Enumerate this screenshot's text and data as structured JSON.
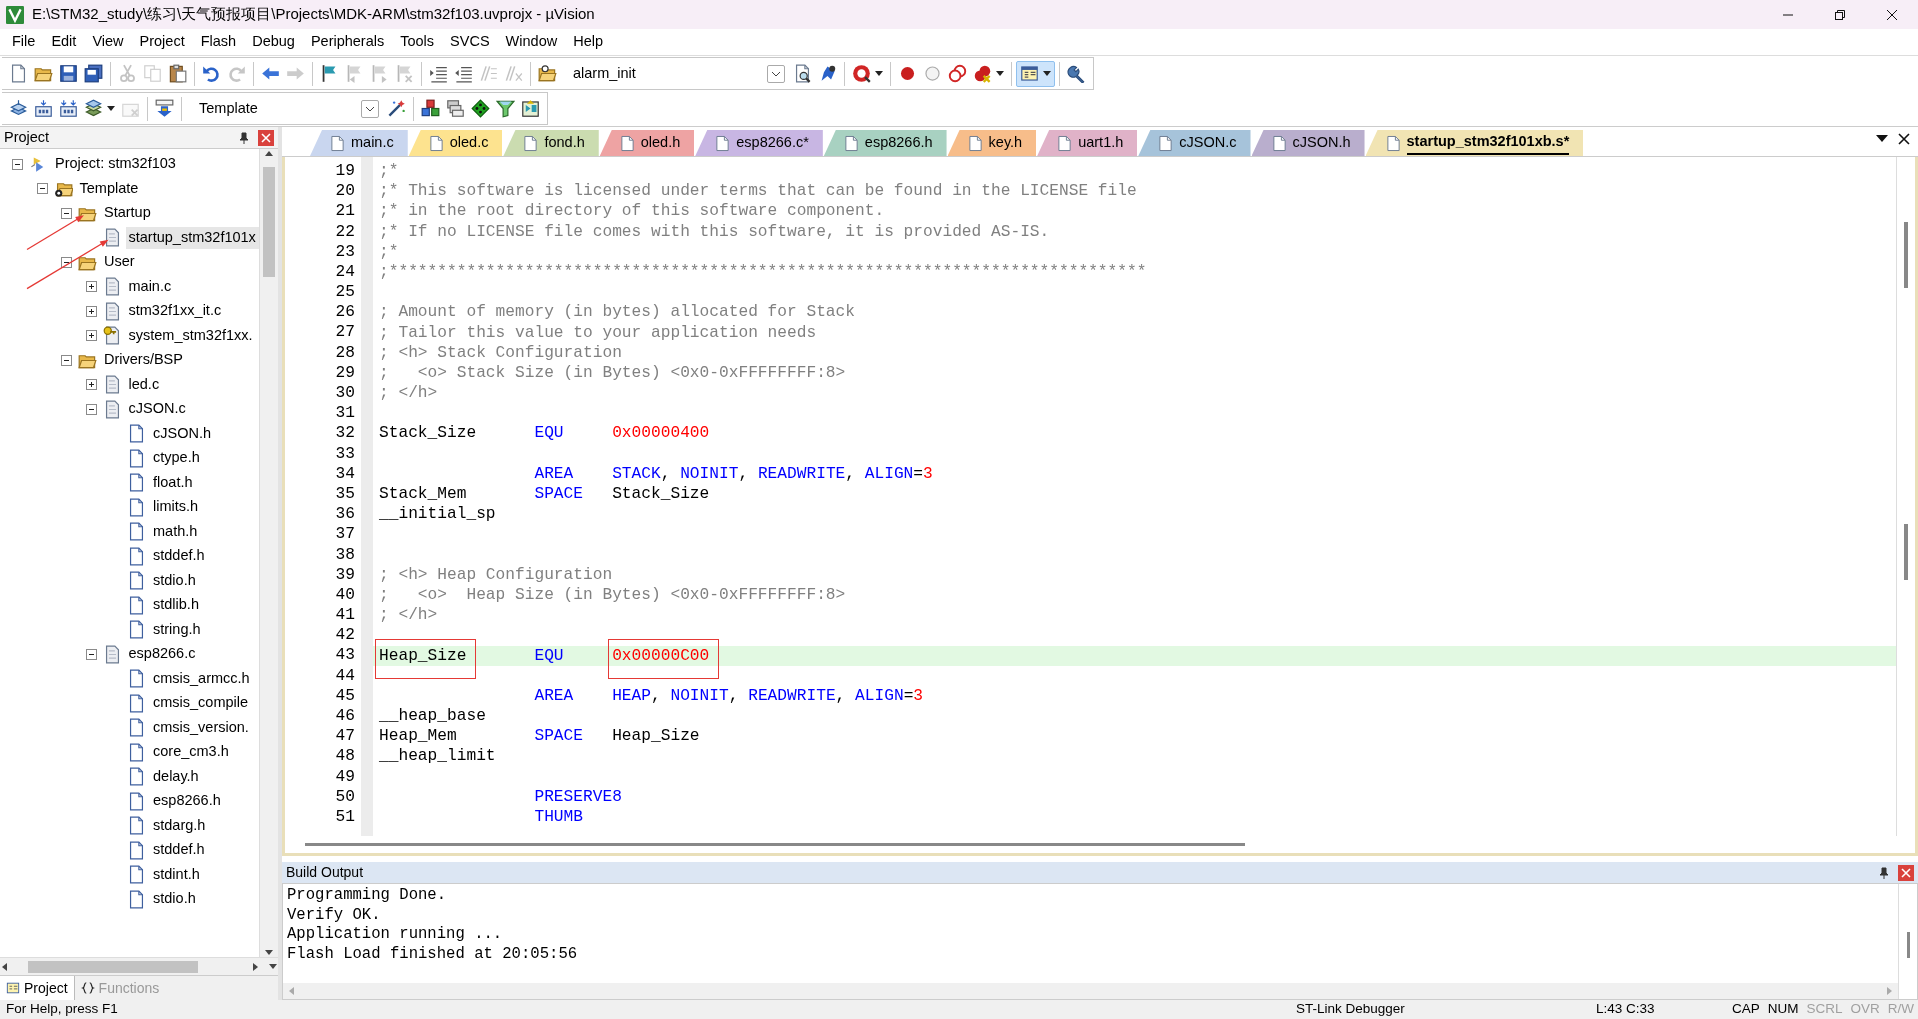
{
  "window": {
    "title": "E:\\STM32_study\\练习\\天气预报项目\\Projects\\MDK-ARM\\stm32f103.uvprojx - µVision"
  },
  "menu": [
    "File",
    "Edit",
    "View",
    "Project",
    "Flash",
    "Debug",
    "Peripherals",
    "Tools",
    "SVCS",
    "Window",
    "Help"
  ],
  "toolbar_1": [
    {
      "kind": "new",
      "disabled": false
    },
    {
      "kind": "open",
      "disabled": false
    },
    {
      "kind": "save",
      "disabled": false
    },
    {
      "kind": "save-all",
      "disabled": false
    },
    {
      "kind": "separator"
    },
    {
      "kind": "cut",
      "disabled": true
    },
    {
      "kind": "copy",
      "disabled": true
    },
    {
      "kind": "paste",
      "disabled": false
    },
    {
      "kind": "separator"
    },
    {
      "kind": "undo",
      "disabled": false
    },
    {
      "kind": "redo",
      "disabled": true
    },
    {
      "kind": "separator"
    },
    {
      "kind": "back",
      "disabled": false
    },
    {
      "kind": "forward",
      "disabled": true
    },
    {
      "kind": "separator"
    },
    {
      "kind": "bookmark",
      "disabled": false
    },
    {
      "kind": "prev-bookmark",
      "disabled": true
    },
    {
      "kind": "next-bookmark",
      "disabled": true
    },
    {
      "kind": "clear-bookmarks",
      "disabled": true
    },
    {
      "kind": "separator"
    },
    {
      "kind": "indent",
      "disabled": false
    },
    {
      "kind": "unindent",
      "disabled": false
    },
    {
      "kind": "comment",
      "disabled": true
    },
    {
      "kind": "uncomment",
      "disabled": true
    },
    {
      "kind": "separator"
    },
    {
      "kind": "find-in-files",
      "disabled": false
    },
    {
      "kind": "combo",
      "value": "alarm_init"
    },
    {
      "kind": "find",
      "disabled": false
    },
    {
      "kind": "incremental-find",
      "disabled": false
    },
    {
      "kind": "separator"
    },
    {
      "kind": "debug",
      "disabled": false,
      "dropdown": true
    },
    {
      "kind": "separator"
    },
    {
      "kind": "breakpoint",
      "disabled": false
    },
    {
      "kind": "breakpoint-off",
      "disabled": false
    },
    {
      "kind": "disable-all",
      "disabled": false
    },
    {
      "kind": "kill-all",
      "disabled": false,
      "dropdown": true
    },
    {
      "kind": "separator"
    },
    {
      "kind": "layout",
      "disabled": false,
      "dropdown": true,
      "on": true
    },
    {
      "kind": "separator"
    },
    {
      "kind": "configure",
      "disabled": false
    }
  ],
  "toolbar_2": [
    {
      "kind": "translate",
      "disabled": false
    },
    {
      "kind": "build",
      "disabled": false
    },
    {
      "kind": "rebuild",
      "disabled": false
    },
    {
      "kind": "batch-build",
      "disabled": false,
      "dropdown": true
    },
    {
      "kind": "stop-build",
      "disabled": true
    },
    {
      "kind": "separator"
    },
    {
      "kind": "download",
      "disabled": false
    },
    {
      "kind": "separator"
    },
    {
      "kind": "combo",
      "value": "Template"
    },
    {
      "kind": "target-options",
      "disabled": false
    },
    {
      "kind": "separator"
    },
    {
      "kind": "manage-items",
      "disabled": false
    },
    {
      "kind": "select-packs",
      "disabled": false
    },
    {
      "kind": "manage-environment",
      "disabled": false
    },
    {
      "kind": "pack-installer",
      "disabled": false
    },
    {
      "kind": "runtime-environment",
      "disabled": false
    }
  ],
  "project_panel": {
    "title": "Project",
    "tree": [
      {
        "label": "Project: stm32f103",
        "kind": "project",
        "expanded": true,
        "selected": false,
        "arrow": false,
        "children": [
          {
            "label": "Template",
            "kind": "target",
            "expanded": true,
            "selected": false,
            "arrow": false,
            "children": [
              {
                "label": "Startup",
                "kind": "folder",
                "expanded": true,
                "selected": false,
                "arrow": true,
                "children": [
                  {
                    "label": "startup_stm32f101x",
                    "kind": "file",
                    "selected": true,
                    "arrow": true
                  }
                ]
              },
              {
                "label": "User",
                "kind": "folder",
                "expanded": true,
                "selected": false,
                "arrow": false,
                "children": [
                  {
                    "label": "main.c",
                    "kind": "file",
                    "expanded": false,
                    "selected": false,
                    "arrow": false
                  },
                  {
                    "label": "stm32f1xx_it.c",
                    "kind": "file",
                    "expanded": false,
                    "selected": false,
                    "arrow": false
                  },
                  {
                    "label": "system_stm32f1xx.",
                    "kind": "config",
                    "expanded": false,
                    "selected": false,
                    "arrow": false
                  }
                ]
              },
              {
                "label": "Drivers/BSP",
                "kind": "folder",
                "expanded": true,
                "selected": false,
                "arrow": false,
                "children": [
                  {
                    "label": "led.c",
                    "kind": "file",
                    "expanded": false,
                    "selected": false,
                    "arrow": false
                  },
                  {
                    "label": "cJSON.c",
                    "kind": "file",
                    "expanded": true,
                    "selected": false,
                    "arrow": false,
                    "children": [
                      {
                        "label": "cJSON.h",
                        "kind": "header",
                        "selected": false,
                        "arrow": false
                      },
                      {
                        "label": "ctype.h",
                        "kind": "header",
                        "selected": false,
                        "arrow": false
                      },
                      {
                        "label": "float.h",
                        "kind": "header",
                        "selected": false,
                        "arrow": false
                      },
                      {
                        "label": "limits.h",
                        "kind": "header",
                        "selected": false,
                        "arrow": false
                      },
                      {
                        "label": "math.h",
                        "kind": "header",
                        "selected": false,
                        "arrow": false
                      },
                      {
                        "label": "stddef.h",
                        "kind": "header",
                        "selected": false,
                        "arrow": false
                      },
                      {
                        "label": "stdio.h",
                        "kind": "header",
                        "selected": false,
                        "arrow": false
                      },
                      {
                        "label": "stdlib.h",
                        "kind": "header",
                        "selected": false,
                        "arrow": false
                      },
                      {
                        "label": "string.h",
                        "kind": "header",
                        "selected": false,
                        "arrow": false
                      }
                    ]
                  },
                  {
                    "label": "esp8266.c",
                    "kind": "file",
                    "expanded": true,
                    "selected": false,
                    "arrow": false,
                    "children": [
                      {
                        "label": "cmsis_armcc.h",
                        "kind": "header",
                        "selected": false,
                        "arrow": false
                      },
                      {
                        "label": "cmsis_compile",
                        "kind": "header",
                        "selected": false,
                        "arrow": false
                      },
                      {
                        "label": "cmsis_version.",
                        "kind": "header",
                        "selected": false,
                        "arrow": false
                      },
                      {
                        "label": "core_cm3.h",
                        "kind": "header",
                        "selected": false,
                        "arrow": false
                      },
                      {
                        "label": "delay.h",
                        "kind": "header",
                        "selected": false,
                        "arrow": false
                      },
                      {
                        "label": "esp8266.h",
                        "kind": "header",
                        "selected": false,
                        "arrow": false
                      },
                      {
                        "label": "stdarg.h",
                        "kind": "header",
                        "selected": false,
                        "arrow": false
                      },
                      {
                        "label": "stddef.h",
                        "kind": "header",
                        "selected": false,
                        "arrow": false
                      },
                      {
                        "label": "stdint.h",
                        "kind": "header",
                        "selected": false,
                        "arrow": false
                      },
                      {
                        "label": "stdio.h",
                        "kind": "header",
                        "selected": false,
                        "arrow": false
                      }
                    ]
                  }
                ]
              }
            ]
          }
        ]
      }
    ],
    "tabs": [
      {
        "label": "Project",
        "kind": "project",
        "selected": true
      },
      {
        "label": "Functions",
        "kind": "functions",
        "selected": false
      }
    ]
  },
  "editor_tabs": [
    {
      "label": "main.c",
      "color": "#c9d6ef",
      "selected": false
    },
    {
      "label": "oled.c",
      "color": "#fde38f",
      "selected": false
    },
    {
      "label": "fond.h",
      "color": "#cbdcb0",
      "selected": false
    },
    {
      "label": "oled.h",
      "color": "#eea3a3",
      "selected": false
    },
    {
      "label": "esp8266.c*",
      "color": "#c8b6e3",
      "selected": false
    },
    {
      "label": "esp8266.h",
      "color": "#a8d1c1",
      "selected": false
    },
    {
      "label": "key.h",
      "color": "#f7bd8a",
      "selected": false
    },
    {
      "label": "uart1.h",
      "color": "#e0b2c8",
      "selected": false
    },
    {
      "label": "cJSON.c",
      "color": "#a6c3da",
      "selected": false
    },
    {
      "label": "cJSON.h",
      "color": "#b9aecd",
      "selected": false
    },
    {
      "label": "startup_stm32f101xb.s*",
      "color": "#f1e4b3",
      "selected": true
    }
  ],
  "editor": {
    "lines": [
      {
        "number": "19",
        "current": false,
        "tokens": [
          {
            "kind": "comment",
            "text": ";*"
          }
        ]
      },
      {
        "number": "20",
        "current": false,
        "tokens": [
          {
            "kind": "comment",
            "text": ";* This software is licensed under terms that can be found in the LICENSE file"
          }
        ]
      },
      {
        "number": "21",
        "current": false,
        "tokens": [
          {
            "kind": "comment",
            "text": ";* in the root directory of this software component."
          }
        ]
      },
      {
        "number": "22",
        "current": false,
        "tokens": [
          {
            "kind": "comment",
            "text": ";* If no LICENSE file comes with this software, it is provided AS-IS."
          }
        ]
      },
      {
        "number": "23",
        "current": false,
        "tokens": [
          {
            "kind": "comment",
            "text": ";*"
          }
        ]
      },
      {
        "number": "24",
        "current": false,
        "tokens": [
          {
            "kind": "comment",
            "text": ";******************************************************************************"
          }
        ]
      },
      {
        "number": "25",
        "current": false
      },
      {
        "number": "26",
        "current": false,
        "tokens": [
          {
            "kind": "comment",
            "text": "; Amount of memory (in bytes) allocated for Stack"
          }
        ]
      },
      {
        "number": "27",
        "current": false,
        "tokens": [
          {
            "kind": "comment",
            "text": "; Tailor this value to your application needs"
          }
        ]
      },
      {
        "number": "28",
        "current": false,
        "tokens": [
          {
            "kind": "comment",
            "text": "; <h> Stack Configuration"
          }
        ]
      },
      {
        "number": "29",
        "current": false,
        "tokens": [
          {
            "kind": "comment",
            "text": ";   <o> Stack Size (in Bytes) <0x0-0xFFFFFFFF:8>"
          }
        ]
      },
      {
        "number": "30",
        "current": false,
        "tokens": [
          {
            "kind": "comment",
            "text": "; </h>"
          }
        ]
      },
      {
        "number": "31",
        "current": false
      },
      {
        "number": "32",
        "current": false,
        "tokens": [
          {
            "kind": "plain",
            "text": "Stack_Size      "
          },
          {
            "kind": "keyword",
            "text": "EQU     "
          },
          {
            "kind": "number",
            "text": "0x00000400"
          }
        ]
      },
      {
        "number": "33",
        "current": false
      },
      {
        "number": "34",
        "current": false,
        "tokens": [
          {
            "kind": "keyword",
            "text": "                AREA    STACK"
          },
          {
            "kind": "plain",
            "text": ", "
          },
          {
            "kind": "keyword",
            "text": "NOINIT"
          },
          {
            "kind": "plain",
            "text": ", "
          },
          {
            "kind": "keyword",
            "text": "READWRITE"
          },
          {
            "kind": "plain",
            "text": ", "
          },
          {
            "kind": "keyword",
            "text": "ALIGN"
          },
          {
            "kind": "plain",
            "text": "="
          },
          {
            "kind": "number",
            "text": "3"
          }
        ]
      },
      {
        "number": "35",
        "current": false,
        "tokens": [
          {
            "kind": "plain",
            "text": "Stack_Mem       "
          },
          {
            "kind": "keyword",
            "text": "SPACE   "
          },
          {
            "kind": "plain",
            "text": "Stack_Size"
          }
        ]
      },
      {
        "number": "36",
        "current": false,
        "tokens": [
          {
            "kind": "plain",
            "text": "__initial_sp"
          }
        ]
      },
      {
        "number": "37",
        "current": false
      },
      {
        "number": "38",
        "current": false
      },
      {
        "number": "39",
        "current": false,
        "tokens": [
          {
            "kind": "comment",
            "text": "; <h> Heap Configuration"
          }
        ]
      },
      {
        "number": "40",
        "current": false,
        "tokens": [
          {
            "kind": "comment",
            "text": ";   <o>  Heap Size (in Bytes) <0x0-0xFFFFFFFF:8>"
          }
        ]
      },
      {
        "number": "41",
        "current": false,
        "tokens": [
          {
            "kind": "comment",
            "text": "; </h>"
          }
        ]
      },
      {
        "number": "42",
        "current": false
      },
      {
        "number": "43",
        "current": true,
        "tokens": [
          {
            "kind": "plain",
            "text": "Heap_Size",
            "boxed": true
          },
          {
            "kind": "keyword",
            "text": "       EQU     ",
            "boxed": false
          },
          {
            "kind": "number",
            "text": "0x00000C00",
            "boxed": true
          }
        ]
      },
      {
        "number": "44",
        "current": false
      },
      {
        "number": "45",
        "current": false,
        "tokens": [
          {
            "kind": "keyword",
            "text": "                AREA    HEAP"
          },
          {
            "kind": "plain",
            "text": ", "
          },
          {
            "kind": "keyword",
            "text": "NOINIT"
          },
          {
            "kind": "plain",
            "text": ", "
          },
          {
            "kind": "keyword",
            "text": "READWRITE"
          },
          {
            "kind": "plain",
            "text": ", "
          },
          {
            "kind": "keyword",
            "text": "ALIGN"
          },
          {
            "kind": "plain",
            "text": "="
          },
          {
            "kind": "number",
            "text": "3"
          }
        ]
      },
      {
        "number": "46",
        "current": false,
        "tokens": [
          {
            "kind": "plain",
            "text": "__heap_base"
          }
        ]
      },
      {
        "number": "47",
        "current": false,
        "tokens": [
          {
            "kind": "plain",
            "text": "Heap_Mem        "
          },
          {
            "kind": "keyword",
            "text": "SPACE   "
          },
          {
            "kind": "plain",
            "text": "Heap_Size"
          }
        ]
      },
      {
        "number": "48",
        "current": false,
        "tokens": [
          {
            "kind": "plain",
            "text": "__heap_limit"
          }
        ]
      },
      {
        "number": "49",
        "current": false
      },
      {
        "number": "50",
        "current": false,
        "tokens": [
          {
            "kind": "keyword",
            "text": "                PRESERVE8"
          }
        ]
      },
      {
        "number": "51",
        "current": false,
        "tokens": [
          {
            "kind": "keyword",
            "text": "                THUMB"
          }
        ]
      }
    ]
  },
  "build_output": {
    "title": "Build Output",
    "lines": [
      "Programming Done.",
      "Verify OK.",
      "Application running ...",
      "Flash Load finished at 20:05:56"
    ]
  },
  "status_bar": {
    "help": "For Help, press F1",
    "debugger": "ST-Link Debugger",
    "position": "L:43 C:33",
    "indicators": [
      {
        "label": "CAP",
        "on": true
      },
      {
        "label": "NUM",
        "on": true
      },
      {
        "label": "SCRL",
        "on": false
      },
      {
        "label": "OVR",
        "on": false
      },
      {
        "label": "R/W",
        "on": false
      }
    ]
  }
}
